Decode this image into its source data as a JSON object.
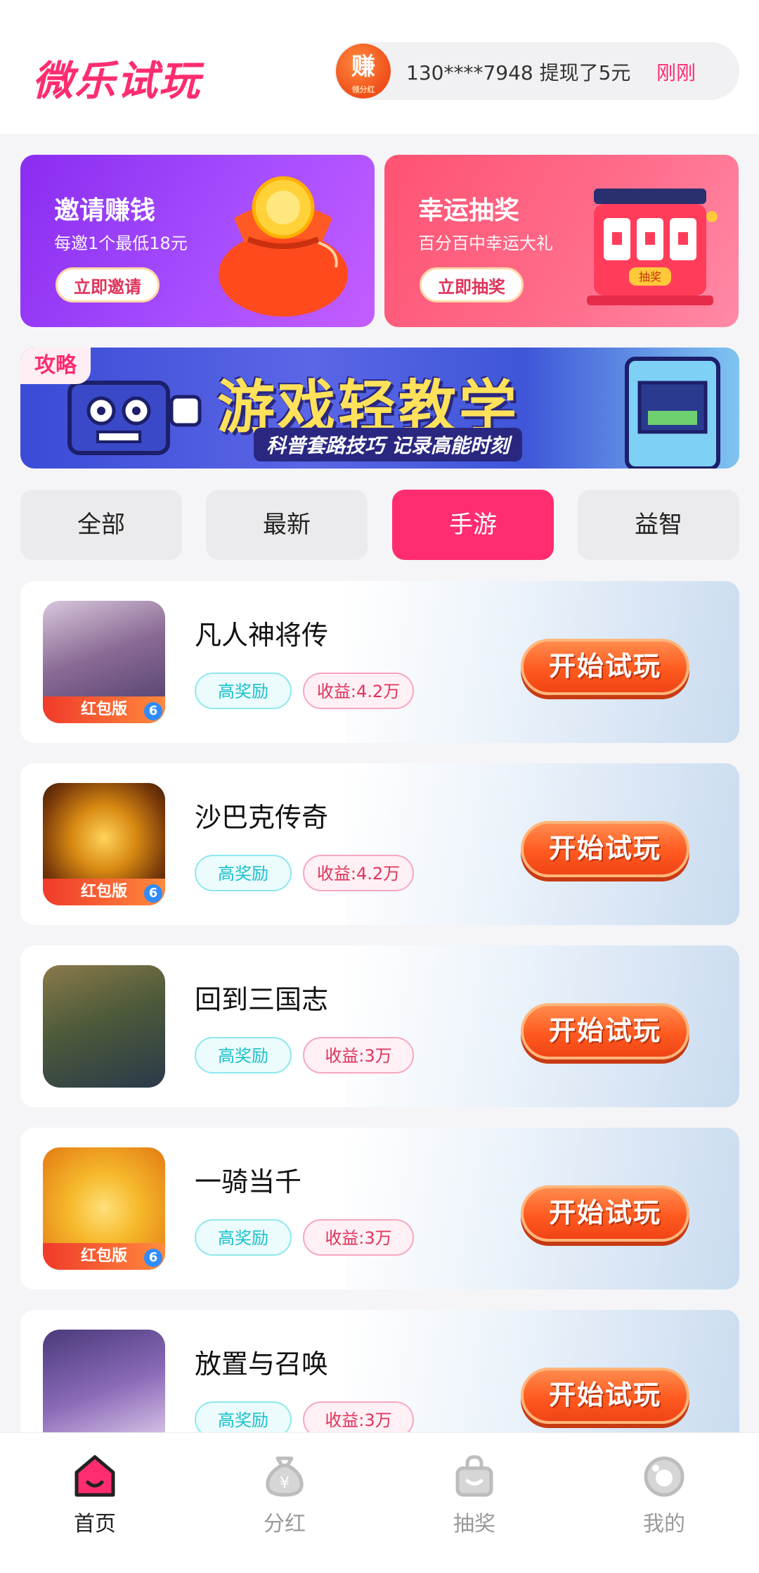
{
  "header": {
    "logo": "微乐试玩",
    "ticker": {
      "badge_main": "赚",
      "badge_sub": "领分红",
      "message": "130****7948 提现了5元",
      "time": "刚刚"
    }
  },
  "promos": [
    {
      "title": "邀请赚钱",
      "subtitle": "每邀1个最低18元",
      "button": "立即邀请"
    },
    {
      "title": "幸运抽奖",
      "subtitle": "百分百中幸运大礼",
      "button": "立即抽奖",
      "art_label": "抽奖"
    }
  ],
  "guide_banner": {
    "tag": "攻略",
    "title": "游戏轻教学",
    "subtitle": "科普套路技巧 记录高能时刻"
  },
  "tabs": [
    {
      "label": "全部",
      "active": false
    },
    {
      "label": "最新",
      "active": false
    },
    {
      "label": "手游",
      "active": true
    },
    {
      "label": "益智",
      "active": false
    }
  ],
  "games": [
    {
      "name": "凡人神将传",
      "tag_high": "高奖励",
      "tag_income": "收益:4.2万",
      "badge": "红包版",
      "button": "开始试玩",
      "icon_color": "#6f5a8a"
    },
    {
      "name": "沙巴克传奇",
      "tag_high": "高奖励",
      "tag_income": "收益:4.2万",
      "badge": "红包版",
      "button": "开始试玩",
      "icon_color": "#7a3a0a"
    },
    {
      "name": "回到三国志",
      "tag_high": "高奖励",
      "tag_income": "收益:3万",
      "badge": "",
      "button": "开始试玩",
      "icon_color": "#4d5a3a"
    },
    {
      "name": "一骑当千",
      "tag_high": "高奖励",
      "tag_income": "收益:3万",
      "badge": "红包版",
      "button": "开始试玩",
      "icon_color": "#f29a1c"
    },
    {
      "name": "放置与召唤",
      "tag_high": "高奖励",
      "tag_income": "收益:3万",
      "badge": "",
      "button": "开始试玩",
      "icon_color": "#5a3f8a"
    }
  ],
  "bottom_nav": [
    {
      "label": "首页",
      "icon": "home-icon",
      "active": true
    },
    {
      "label": "分红",
      "icon": "money-bag-icon",
      "active": false
    },
    {
      "label": "抽奖",
      "icon": "shopping-bag-icon",
      "active": false
    },
    {
      "label": "我的",
      "icon": "profile-icon",
      "active": false
    }
  ],
  "colors": {
    "accent": "#ff2d6f",
    "cyan_tag": "#19c2cc",
    "play_button": "#ff5a1f"
  }
}
